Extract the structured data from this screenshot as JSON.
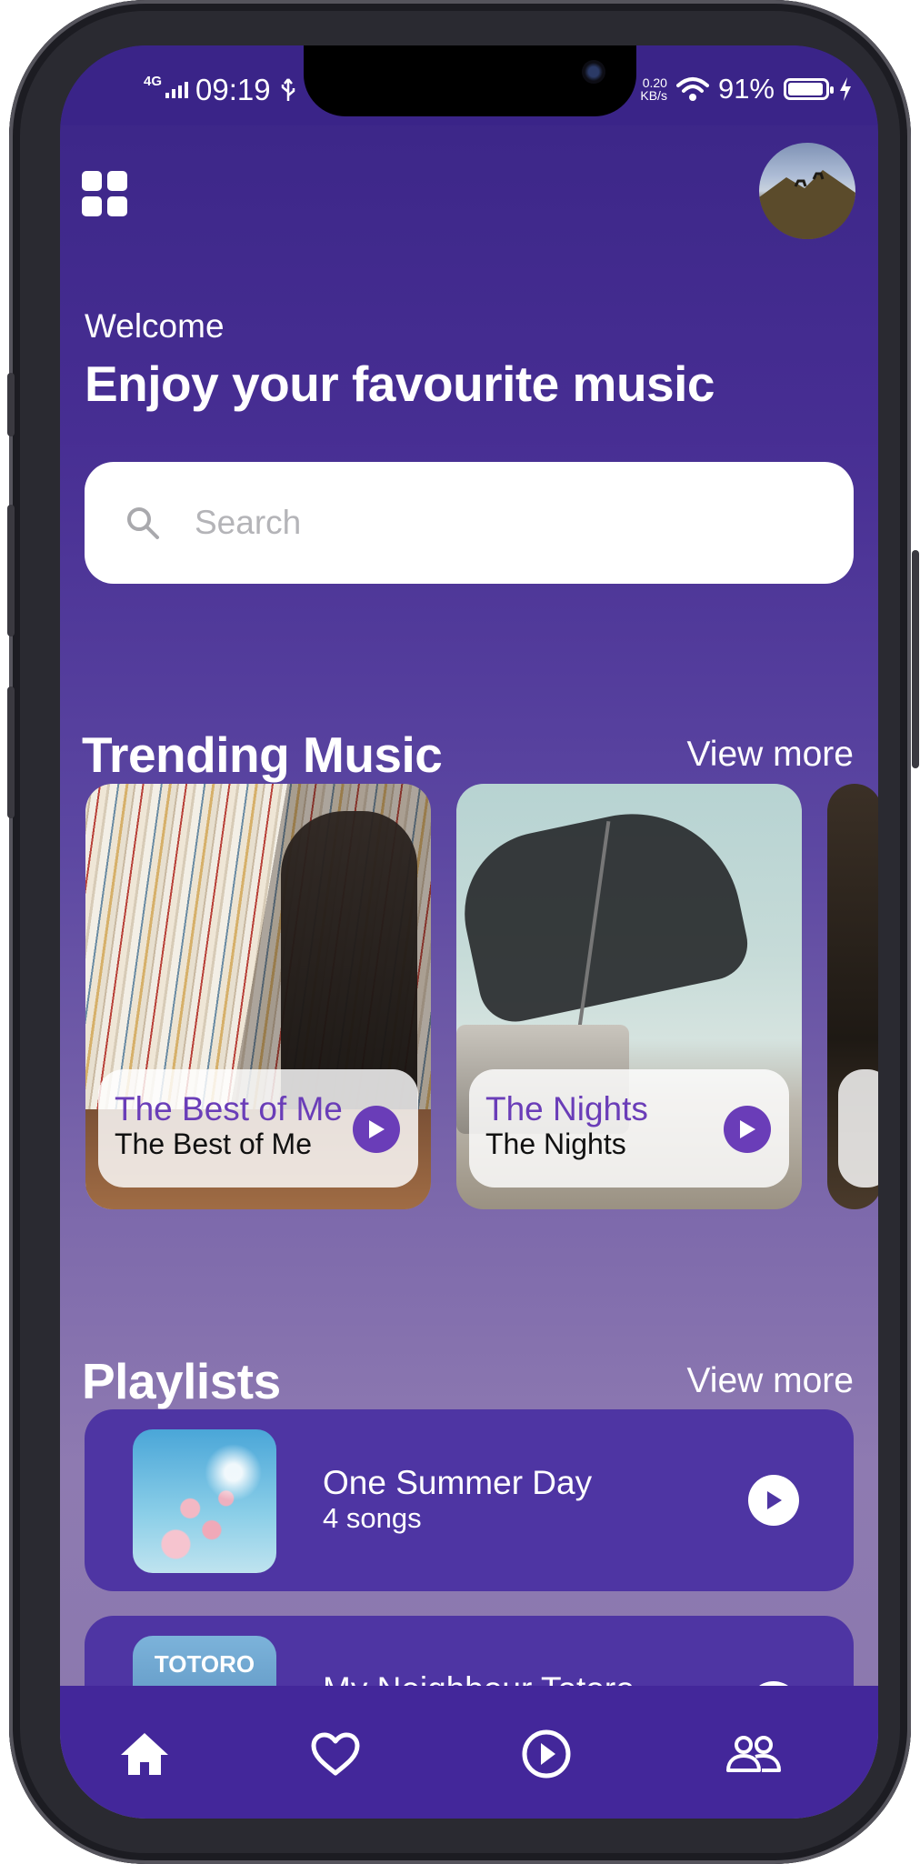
{
  "status_bar": {
    "network": "4G",
    "time": "09:19",
    "speed_value": "0.20",
    "speed_unit": "KB/s",
    "battery": "91%"
  },
  "header": {
    "welcome": "Welcome",
    "headline": "Enjoy your favourite music"
  },
  "search": {
    "placeholder": "Search"
  },
  "trending": {
    "title": "Trending Music",
    "view_more": "View more",
    "cards": [
      {
        "title": "The Best of Me",
        "subtitle": "The Best of Me"
      },
      {
        "title": "The Nights",
        "subtitle": "The Nights"
      }
    ]
  },
  "playlists": {
    "title": "Playlists",
    "view_more": "View more",
    "items": [
      {
        "title": "One Summer Day",
        "subtitle": "4 songs"
      },
      {
        "title": "My Neighbour Totoro",
        "thumb_text": "TOTORO"
      }
    ]
  },
  "bottom_nav": {
    "items": [
      {
        "icon": "home-icon",
        "active": true
      },
      {
        "icon": "heart-icon",
        "active": false
      },
      {
        "icon": "play-circle-icon",
        "active": false
      },
      {
        "icon": "people-icon",
        "active": false
      }
    ]
  },
  "colors": {
    "accent": "#6a3db8",
    "nav_background": "#43279a",
    "playlist_background": "#4e35a3"
  }
}
